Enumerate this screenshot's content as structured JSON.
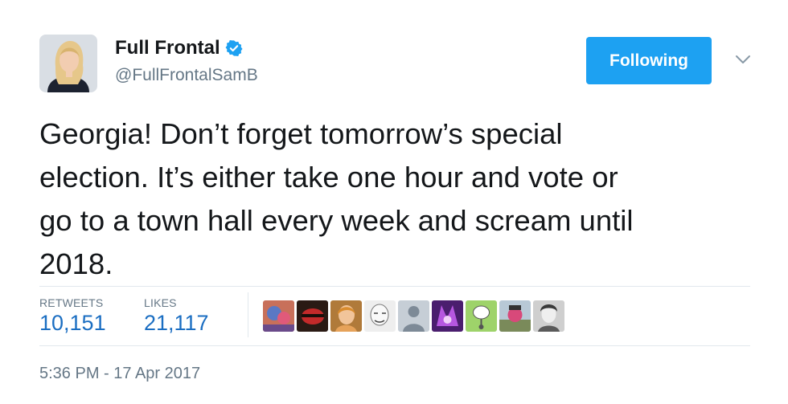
{
  "header": {
    "display_name": "Full Frontal",
    "handle": "@FullFrontalSamB",
    "verified_icon": "verified-badge-icon",
    "follow_button_label": "Following",
    "caret_icon": "chevron-down-icon"
  },
  "tweet": {
    "text": "Georgia! Don’t forget tomorrow’s special\nelection. It’s either take one hour and vote or\ngo to a town hall every week and scream until\n2018."
  },
  "stats": {
    "retweets_label": "RETWEETS",
    "retweets_value": "10,151",
    "likes_label": "LIKES",
    "likes_value": "21,117"
  },
  "likers": [
    {
      "icon": "liker-avatar-1"
    },
    {
      "icon": "liker-avatar-2"
    },
    {
      "icon": "liker-avatar-3"
    },
    {
      "icon": "liker-avatar-4"
    },
    {
      "icon": "liker-avatar-5"
    },
    {
      "icon": "liker-avatar-6"
    },
    {
      "icon": "liker-avatar-7"
    },
    {
      "icon": "liker-avatar-8"
    },
    {
      "icon": "liker-avatar-9"
    }
  ],
  "timestamp": "5:36 PM - 17 Apr 2017",
  "colors": {
    "accent": "#1da1f2",
    "stat_value": "#1b6ec2",
    "muted": "#657786",
    "text": "#14171a"
  }
}
